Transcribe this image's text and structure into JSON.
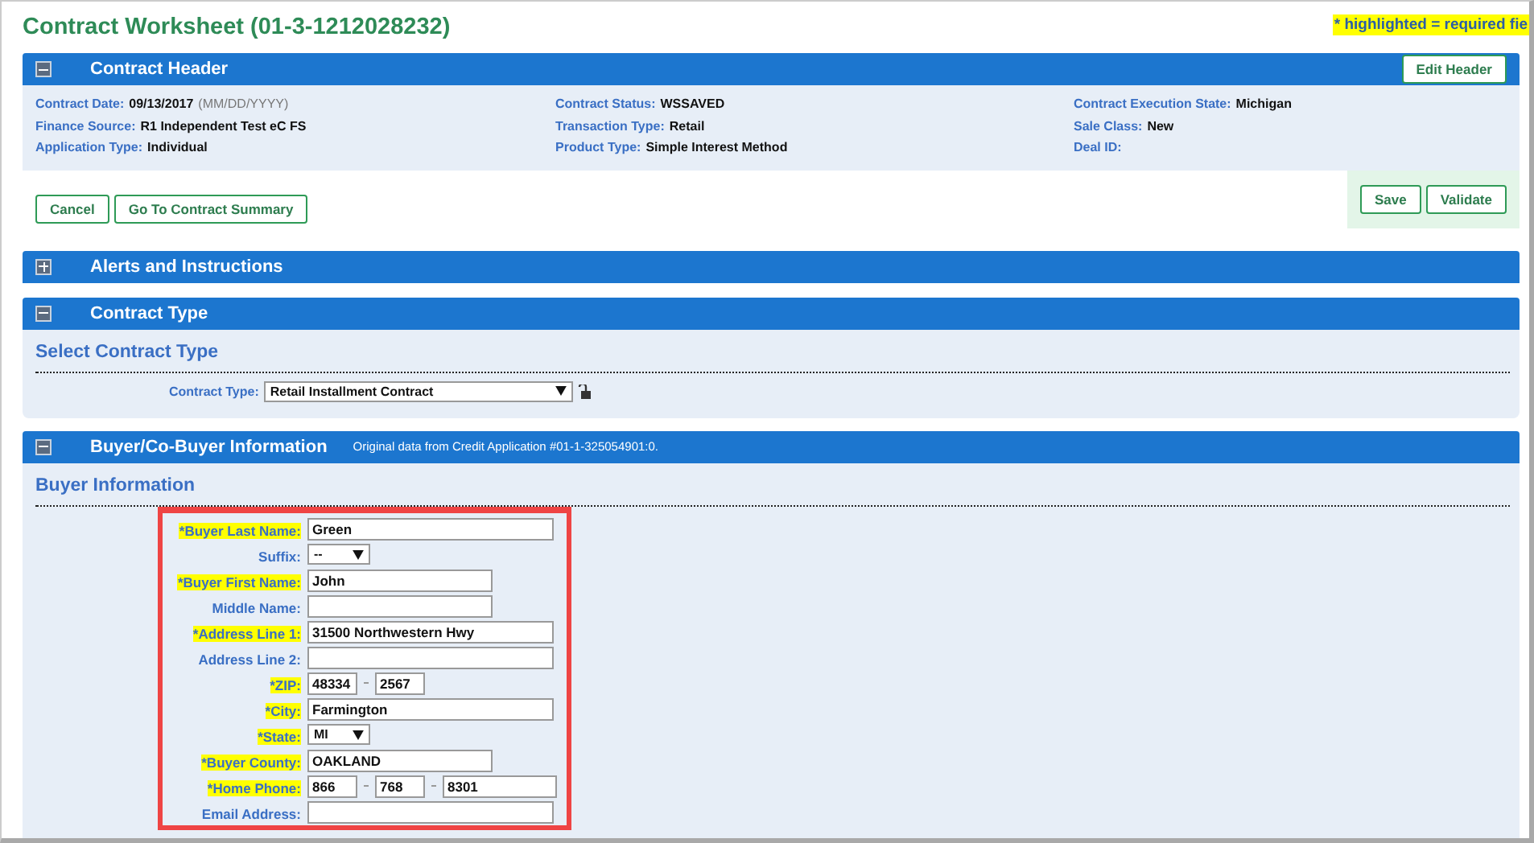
{
  "page_title": "Contract Worksheet (01-3-1212028232)",
  "required_note": "* highlighted = required fie",
  "contract_header": {
    "title": "Contract Header",
    "expanded": true,
    "edit_button": "Edit Header",
    "fields": [
      [
        {
          "label": "Contract Date:",
          "value": "09/13/2017",
          "hint": "(MM/DD/YYYY)"
        },
        {
          "label": "Finance Source:",
          "value": "R1 Independent Test eC FS"
        },
        {
          "label": "Application Type:",
          "value": "Individual"
        }
      ],
      [
        {
          "label": "Contract Status:",
          "value": "WSSAVED"
        },
        {
          "label": "Transaction Type:",
          "value": "Retail"
        },
        {
          "label": "Product Type:",
          "value": "Simple Interest Method"
        }
      ],
      [
        {
          "label": "Contract Execution State:",
          "value": "Michigan"
        },
        {
          "label": "Sale Class:",
          "value": "New"
        },
        {
          "label": "Deal ID:"
        }
      ]
    ]
  },
  "left_buttons": [
    "Cancel",
    "Go To Contract Summary"
  ],
  "right_buttons": [
    "Save",
    "Validate"
  ],
  "alerts": {
    "title": "Alerts and Instructions",
    "expanded": false
  },
  "contract_type": {
    "title": "Contract Type",
    "expanded": true,
    "subtitle": "Select Contract Type",
    "label": "Contract Type:",
    "value": "Retail Installment Contract"
  },
  "buyer": {
    "title": "Buyer/Co-Buyer Information",
    "expanded": true,
    "note": "Original data from Credit Application #01-1-325054901:0.",
    "subtitle": "Buyer Information",
    "fields": [
      {
        "label": "*Buyer Last Name:",
        "required": true,
        "kind": "long",
        "values": [
          "Green"
        ]
      },
      {
        "label": "Suffix:",
        "required": false,
        "kind": "select",
        "values": [
          "--"
        ]
      },
      {
        "label": "*Buyer First Name:",
        "required": true,
        "kind": "short",
        "values": [
          "John"
        ]
      },
      {
        "label": "Middle Name:",
        "required": false,
        "kind": "short"
      },
      {
        "label": "*Address Line 1:",
        "required": true,
        "kind": "long",
        "values": [
          "31500 Northwestern Hwy"
        ]
      },
      {
        "label": "Address Line 2:",
        "required": false,
        "kind": "long"
      },
      {
        "label": "*ZIP:",
        "required": true,
        "kind": "zip",
        "values": [
          "48334",
          "2567"
        ]
      },
      {
        "label": "*City:",
        "required": true,
        "kind": "long",
        "values": [
          "Farmington"
        ]
      },
      {
        "label": "*State:",
        "required": true,
        "kind": "select",
        "values": [
          "MI"
        ]
      },
      {
        "label": "*Buyer County:",
        "required": true,
        "kind": "short",
        "values": [
          "OAKLAND"
        ]
      },
      {
        "label": "*Home Phone:",
        "required": true,
        "kind": "phone",
        "values": [
          "866",
          "768",
          "8301"
        ]
      },
      {
        "label": "Email Address:",
        "required": false,
        "kind": "long"
      }
    ]
  }
}
